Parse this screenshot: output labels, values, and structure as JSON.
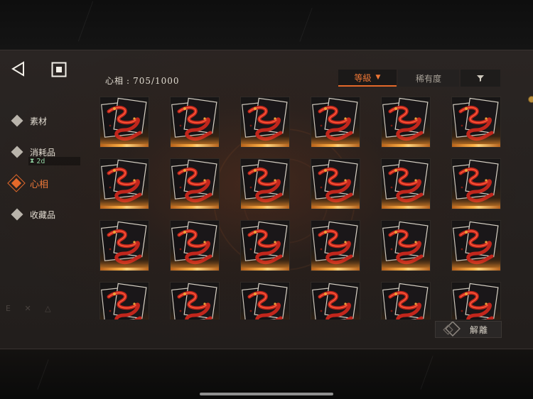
{
  "header": {
    "back_icon": "back-triangle-icon",
    "home_icon": "home-square-icon"
  },
  "sidebar": {
    "items": [
      {
        "label": "素材",
        "icon": "diamond-icon",
        "active": false
      },
      {
        "label": "消耗品",
        "icon": "diamond-icon",
        "active": false,
        "timer": "2d",
        "timer_icon": "hourglass-icon"
      },
      {
        "label": "心相",
        "icon": "diamond-active-icon",
        "active": true
      },
      {
        "label": "收藏品",
        "icon": "diamond-icon",
        "active": false
      }
    ],
    "faint_marks": "E ✕ △"
  },
  "main": {
    "count": {
      "label": "心相",
      "sep": ":",
      "value": "705/1000"
    },
    "sort": {
      "level_label": "等級",
      "level_arrow": "▼",
      "rarity_label": "稀有度",
      "filter_icon": "filter-funnel-icon"
    },
    "grid": {
      "columns": 6,
      "rows_visible": 4,
      "item_label": "",
      "item_icon": "red-serpent-portrait-icon"
    },
    "release_button": {
      "label": "解離",
      "icon": "diamond-frame-icon"
    }
  },
  "colors": {
    "accent": "#e4692a",
    "text": "#d8d2c6",
    "panel": "#252120",
    "timer": "#8fd0a0",
    "card_glow": "#ffb347"
  }
}
